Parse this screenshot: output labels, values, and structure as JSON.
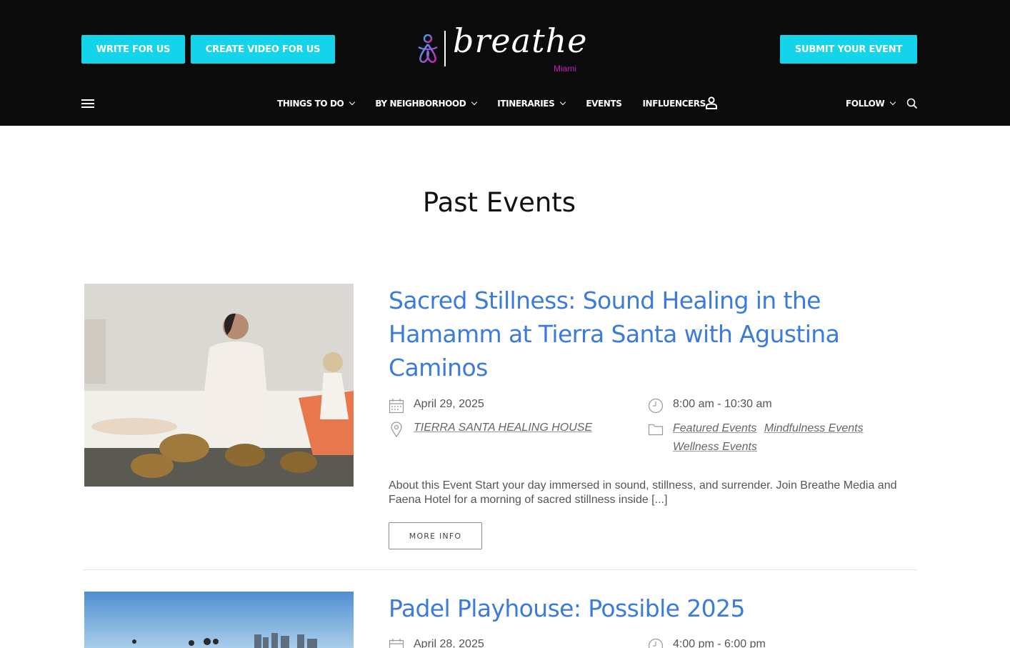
{
  "header": {
    "write_button": "WRITE FOR US",
    "video_button": "CREATE VIDEO FOR US",
    "submit_button": "SUBMIT YOUR EVENT",
    "logo_word": "breathe",
    "logo_city": "Miami",
    "nav": [
      {
        "label": "THINGS TO DO",
        "dropdown": true
      },
      {
        "label": "BY NEIGHBORHOOD",
        "dropdown": true
      },
      {
        "label": "ITINERARIES",
        "dropdown": true
      },
      {
        "label": "EVENTS",
        "dropdown": false
      },
      {
        "label": "INFLUENCERS",
        "dropdown": false
      }
    ],
    "follow_label": "FOLLOW",
    "icons": [
      "menu-icon",
      "user-icon",
      "search-icon",
      "chevron-down-icon"
    ]
  },
  "main": {
    "page_title": "Past Events",
    "events": [
      {
        "title": "Sacred Stillness: Sound Healing in the Hamamm at Tierra Santa with Agustina Caminos",
        "date": "April 29, 2025",
        "time": "8:00 am - 10:30 am",
        "venue": "TIERRA SANTA HEALING HOUSE",
        "categories": [
          "Featured Events",
          "Mindfulness Events",
          "Wellness Events"
        ],
        "excerpt": "About this Event Start your day immersed in sound, stillness, and surrender. Join Breathe Media and Faena Hotel for a morning of sacred stillness inside [...]",
        "more_label": "MORE INFO"
      },
      {
        "title": "Padel Playhouse: Possible 2025",
        "date": "April 28, 2025",
        "time": "4:00 pm - 6:00 pm"
      }
    ]
  },
  "colors": {
    "header_bg": "#0b0b0c",
    "accent_cyan": "#14d4ec",
    "title_blue": "#3a7bdc",
    "logo_magenta": "#c51fb7"
  }
}
